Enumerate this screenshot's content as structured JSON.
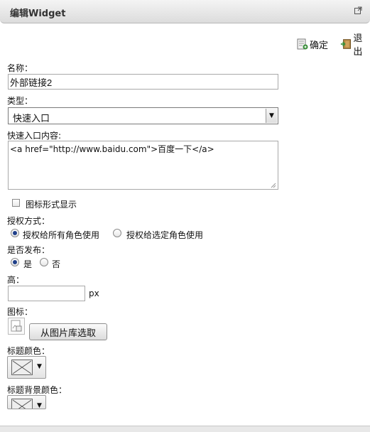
{
  "window": {
    "title": "编辑Widget",
    "popout_icon": "popout-icon"
  },
  "toolbar": {
    "confirm_label": "确定",
    "confirm_icon": "save-icon",
    "exit_label": "退出",
    "exit_icon": "exit-door-icon"
  },
  "form": {
    "name_label": "名称：",
    "name_value": "外部链接2",
    "type_label": "类型：",
    "type_value": "快速入口",
    "content_label": "快速入口内容:",
    "content_value": "<a href=\"http://www.baidu.com\">百度一下</a>",
    "icon_display_label": "图标形式显示",
    "icon_display_checked": false,
    "auth_label": "授权方式：",
    "auth_options": [
      "授权给所有角色使用",
      "授权给选定角色使用"
    ],
    "auth_selected": 0,
    "publish_label": "是否发布：",
    "publish_options": [
      "是",
      "否"
    ],
    "publish_selected": 0,
    "height_label": "高：",
    "height_value": "",
    "height_unit": "px",
    "icon_label": "图标：",
    "pick_button_label": "从图片库选取",
    "title_color_label": "标题颜色：",
    "title_bg_color_label": "标题背景颜色：",
    "dropdown_arrow": "▼"
  }
}
